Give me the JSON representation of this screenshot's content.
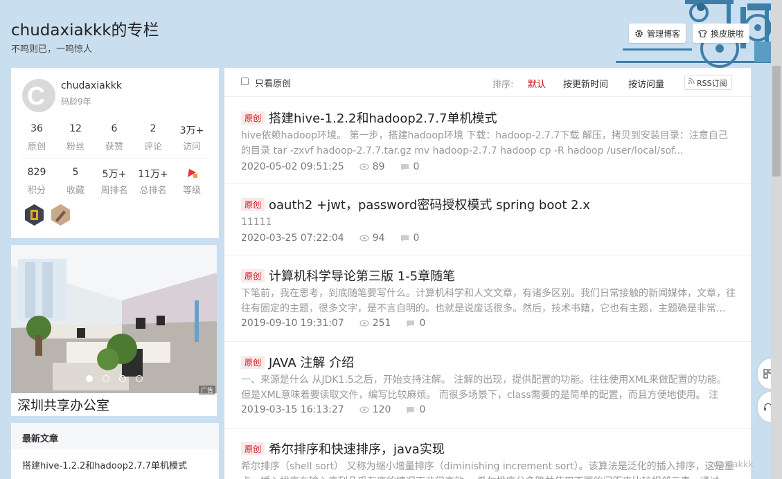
{
  "header": {
    "title": "chudaxiakkk的专栏",
    "subtitle": "不鸣则已，一鸣惊人",
    "manage_label": "管理博客",
    "skin_label": "换皮肤啦"
  },
  "profile": {
    "avatar_letter": "C",
    "username": "chudaxiakkk",
    "age": "码龄9年",
    "stats_row1": [
      {
        "value": "36",
        "label": "原创"
      },
      {
        "value": "12",
        "label": "粉丝"
      },
      {
        "value": "6",
        "label": "获赞"
      },
      {
        "value": "2",
        "label": "评论"
      },
      {
        "value": "3万+",
        "label": "访问"
      }
    ],
    "stats_row2": [
      {
        "value": "829",
        "label": "积分"
      },
      {
        "value": "5",
        "label": "收藏"
      },
      {
        "value": "5万+",
        "label": "周排名"
      },
      {
        "value": "11万+",
        "label": "总排名"
      },
      {
        "value": "",
        "label": "等级"
      }
    ]
  },
  "ad": {
    "caption": "深圳共享办公室",
    "tag": "广告"
  },
  "latest": {
    "heading": "最新文章",
    "items": [
      "搭建hive-1.2.2和hadoop2.7.7单机模式"
    ]
  },
  "toolbar": {
    "only_original": "只看原创",
    "sort_label": "排序:",
    "sort_default": "默认",
    "sort_new": "按更新时间",
    "sort_visit": "按访问量",
    "rss": "RSS订阅"
  },
  "articles": [
    {
      "tag": "原创",
      "title": "搭建hive-1.2.2和hadoop2.7.7单机模式",
      "desc": "hive依赖hadoop环境。 第一步，搭建hadoop环境 下载：hadoop-2.7.7下载 解压，拷贝到安装目录：注意自己的目录 tar -zxvf hadoop-2.7.7.tar.gz mv hadoop-2.7.7 hadoop cp -R hadoop /user/local/sof...",
      "date": "2020-05-02 09:51:25",
      "views": "89",
      "comments": "0"
    },
    {
      "tag": "原创",
      "title": "oauth2 +jwt，password密码授权模式 spring boot 2.x",
      "desc": "11111",
      "date": "2020-03-25 07:22:04",
      "views": "94",
      "comments": "0"
    },
    {
      "tag": "原创",
      "title": "计算机科学导论第三版 1-5章随笔",
      "desc": "下笔前，我在思考，到底随笔要写什么。计算机科学和人文文章，有诸多区别。我们日常接触的新闻媒体，文章，往往有固定的主题，很多文字，是不言自明的。也就是说废话很多。然后，技术书籍，它也有主题，主题确是非常...",
      "date": "2019-09-10 19:31:07",
      "views": "251",
      "comments": "0"
    },
    {
      "tag": "原创",
      "title": "JAVA 注解 介绍",
      "desc": "一、来源是什么 从JDK1.5之后，开始支持注解。 注解的出现，提供配置的功能。往往使用XML来做配置的功能。但是XML意味着要读取文件，编写比较麻烦。 而很多场景下，class需要的是简单的配置，而且方便地使用。 注解...",
      "date": "2019-03-15 16:13:27",
      "views": "120",
      "comments": "0"
    },
    {
      "tag": "原创",
      "title": "希尔排序和快速排序，java实现",
      "desc": "希尔排序（shell sort） 又称为缩小增量排序（diminishing increment sort）。该算法是泛化的插入排序，这是重点。插入排序在输入序列几乎有序的情况下非常高效。 希尔排序分多路并使用不同的间距来比较相邻元素，通过...",
      "date": "",
      "views": "",
      "comments": ""
    }
  ],
  "watermark": "daxiakkk"
}
